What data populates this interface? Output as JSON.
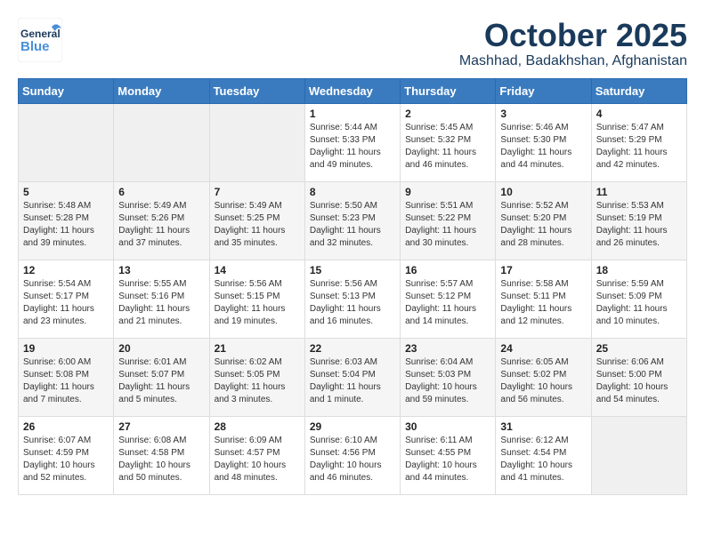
{
  "header": {
    "logo_general": "General",
    "logo_blue": "Blue",
    "month_title": "October 2025",
    "location": "Mashhad, Badakhshan, Afghanistan"
  },
  "days_of_week": [
    "Sunday",
    "Monday",
    "Tuesday",
    "Wednesday",
    "Thursday",
    "Friday",
    "Saturday"
  ],
  "weeks": [
    [
      {
        "day": "",
        "sunrise": "",
        "sunset": "",
        "daylight": ""
      },
      {
        "day": "",
        "sunrise": "",
        "sunset": "",
        "daylight": ""
      },
      {
        "day": "",
        "sunrise": "",
        "sunset": "",
        "daylight": ""
      },
      {
        "day": "1",
        "sunrise": "Sunrise: 5:44 AM",
        "sunset": "Sunset: 5:33 PM",
        "daylight": "Daylight: 11 hours and 49 minutes."
      },
      {
        "day": "2",
        "sunrise": "Sunrise: 5:45 AM",
        "sunset": "Sunset: 5:32 PM",
        "daylight": "Daylight: 11 hours and 46 minutes."
      },
      {
        "day": "3",
        "sunrise": "Sunrise: 5:46 AM",
        "sunset": "Sunset: 5:30 PM",
        "daylight": "Daylight: 11 hours and 44 minutes."
      },
      {
        "day": "4",
        "sunrise": "Sunrise: 5:47 AM",
        "sunset": "Sunset: 5:29 PM",
        "daylight": "Daylight: 11 hours and 42 minutes."
      }
    ],
    [
      {
        "day": "5",
        "sunrise": "Sunrise: 5:48 AM",
        "sunset": "Sunset: 5:28 PM",
        "daylight": "Daylight: 11 hours and 39 minutes."
      },
      {
        "day": "6",
        "sunrise": "Sunrise: 5:49 AM",
        "sunset": "Sunset: 5:26 PM",
        "daylight": "Daylight: 11 hours and 37 minutes."
      },
      {
        "day": "7",
        "sunrise": "Sunrise: 5:49 AM",
        "sunset": "Sunset: 5:25 PM",
        "daylight": "Daylight: 11 hours and 35 minutes."
      },
      {
        "day": "8",
        "sunrise": "Sunrise: 5:50 AM",
        "sunset": "Sunset: 5:23 PM",
        "daylight": "Daylight: 11 hours and 32 minutes."
      },
      {
        "day": "9",
        "sunrise": "Sunrise: 5:51 AM",
        "sunset": "Sunset: 5:22 PM",
        "daylight": "Daylight: 11 hours and 30 minutes."
      },
      {
        "day": "10",
        "sunrise": "Sunrise: 5:52 AM",
        "sunset": "Sunset: 5:20 PM",
        "daylight": "Daylight: 11 hours and 28 minutes."
      },
      {
        "day": "11",
        "sunrise": "Sunrise: 5:53 AM",
        "sunset": "Sunset: 5:19 PM",
        "daylight": "Daylight: 11 hours and 26 minutes."
      }
    ],
    [
      {
        "day": "12",
        "sunrise": "Sunrise: 5:54 AM",
        "sunset": "Sunset: 5:17 PM",
        "daylight": "Daylight: 11 hours and 23 minutes."
      },
      {
        "day": "13",
        "sunrise": "Sunrise: 5:55 AM",
        "sunset": "Sunset: 5:16 PM",
        "daylight": "Daylight: 11 hours and 21 minutes."
      },
      {
        "day": "14",
        "sunrise": "Sunrise: 5:56 AM",
        "sunset": "Sunset: 5:15 PM",
        "daylight": "Daylight: 11 hours and 19 minutes."
      },
      {
        "day": "15",
        "sunrise": "Sunrise: 5:56 AM",
        "sunset": "Sunset: 5:13 PM",
        "daylight": "Daylight: 11 hours and 16 minutes."
      },
      {
        "day": "16",
        "sunrise": "Sunrise: 5:57 AM",
        "sunset": "Sunset: 5:12 PM",
        "daylight": "Daylight: 11 hours and 14 minutes."
      },
      {
        "day": "17",
        "sunrise": "Sunrise: 5:58 AM",
        "sunset": "Sunset: 5:11 PM",
        "daylight": "Daylight: 11 hours and 12 minutes."
      },
      {
        "day": "18",
        "sunrise": "Sunrise: 5:59 AM",
        "sunset": "Sunset: 5:09 PM",
        "daylight": "Daylight: 11 hours and 10 minutes."
      }
    ],
    [
      {
        "day": "19",
        "sunrise": "Sunrise: 6:00 AM",
        "sunset": "Sunset: 5:08 PM",
        "daylight": "Daylight: 11 hours and 7 minutes."
      },
      {
        "day": "20",
        "sunrise": "Sunrise: 6:01 AM",
        "sunset": "Sunset: 5:07 PM",
        "daylight": "Daylight: 11 hours and 5 minutes."
      },
      {
        "day": "21",
        "sunrise": "Sunrise: 6:02 AM",
        "sunset": "Sunset: 5:05 PM",
        "daylight": "Daylight: 11 hours and 3 minutes."
      },
      {
        "day": "22",
        "sunrise": "Sunrise: 6:03 AM",
        "sunset": "Sunset: 5:04 PM",
        "daylight": "Daylight: 11 hours and 1 minute."
      },
      {
        "day": "23",
        "sunrise": "Sunrise: 6:04 AM",
        "sunset": "Sunset: 5:03 PM",
        "daylight": "Daylight: 10 hours and 59 minutes."
      },
      {
        "day": "24",
        "sunrise": "Sunrise: 6:05 AM",
        "sunset": "Sunset: 5:02 PM",
        "daylight": "Daylight: 10 hours and 56 minutes."
      },
      {
        "day": "25",
        "sunrise": "Sunrise: 6:06 AM",
        "sunset": "Sunset: 5:00 PM",
        "daylight": "Daylight: 10 hours and 54 minutes."
      }
    ],
    [
      {
        "day": "26",
        "sunrise": "Sunrise: 6:07 AM",
        "sunset": "Sunset: 4:59 PM",
        "daylight": "Daylight: 10 hours and 52 minutes."
      },
      {
        "day": "27",
        "sunrise": "Sunrise: 6:08 AM",
        "sunset": "Sunset: 4:58 PM",
        "daylight": "Daylight: 10 hours and 50 minutes."
      },
      {
        "day": "28",
        "sunrise": "Sunrise: 6:09 AM",
        "sunset": "Sunset: 4:57 PM",
        "daylight": "Daylight: 10 hours and 48 minutes."
      },
      {
        "day": "29",
        "sunrise": "Sunrise: 6:10 AM",
        "sunset": "Sunset: 4:56 PM",
        "daylight": "Daylight: 10 hours and 46 minutes."
      },
      {
        "day": "30",
        "sunrise": "Sunrise: 6:11 AM",
        "sunset": "Sunset: 4:55 PM",
        "daylight": "Daylight: 10 hours and 44 minutes."
      },
      {
        "day": "31",
        "sunrise": "Sunrise: 6:12 AM",
        "sunset": "Sunset: 4:54 PM",
        "daylight": "Daylight: 10 hours and 41 minutes."
      },
      {
        "day": "",
        "sunrise": "",
        "sunset": "",
        "daylight": ""
      }
    ]
  ]
}
